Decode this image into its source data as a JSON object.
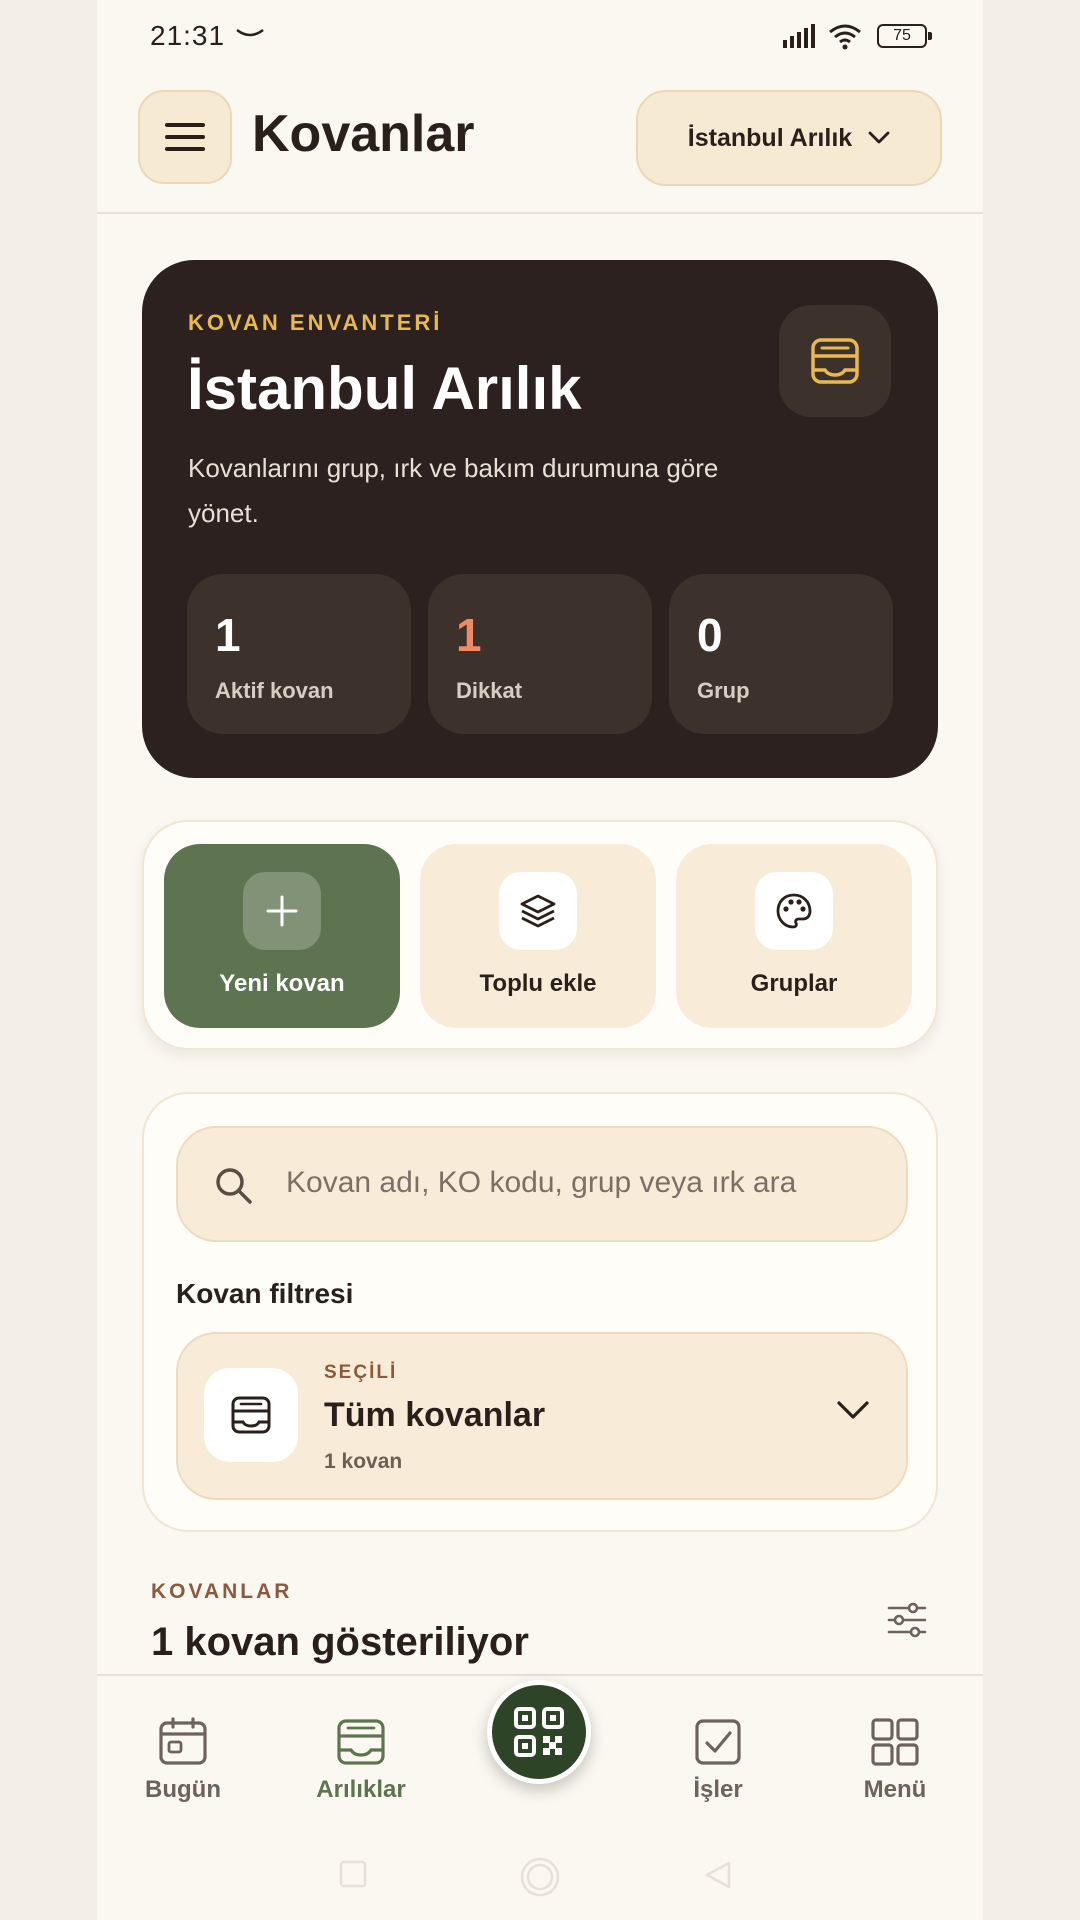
{
  "status_bar": {
    "time": "21:31",
    "battery": "75"
  },
  "header": {
    "title": "Kovanlar",
    "apiary_select": "İstanbul Arılık"
  },
  "hero": {
    "eyebrow": "KOVAN ENVANTERİ",
    "title": "İstanbul Arılık",
    "description": "Kovanlarını grup, ırk ve bakım durumuna göre yönet.",
    "stats": [
      {
        "value": "1",
        "label": "Aktif kovan"
      },
      {
        "value": "1",
        "label": "Dikkat",
        "color": "#ef8a63"
      },
      {
        "value": "0",
        "label": "Grup"
      }
    ]
  },
  "actions": [
    {
      "label": "Yeni kovan",
      "icon": "plus-icon"
    },
    {
      "label": "Toplu ekle",
      "icon": "layers-icon"
    },
    {
      "label": "Gruplar",
      "icon": "palette-icon"
    }
  ],
  "search": {
    "placeholder": "Kovan adı, KO kodu, grup veya ırk ara"
  },
  "filter": {
    "heading": "Kovan filtresi",
    "eyebrow": "SEÇİLİ",
    "value": "Tüm kovanlar",
    "count": "1 kovan"
  },
  "list": {
    "eyebrow": "KOVANLAR",
    "title": "1 kovan gösteriliyor"
  },
  "bottom_nav": [
    {
      "label": "Bugün",
      "icon": "calendar-icon"
    },
    {
      "label": "Arılıklar",
      "icon": "hive-box-icon",
      "active": true
    },
    {
      "label": "İşler",
      "icon": "check-square-icon"
    },
    {
      "label": "Menü",
      "icon": "grid-icon"
    }
  ],
  "colors": {
    "accent_green": "#5e7451",
    "dark_card": "#2c211e",
    "warning": "#ef8a63",
    "gold": "#e9b94f"
  }
}
